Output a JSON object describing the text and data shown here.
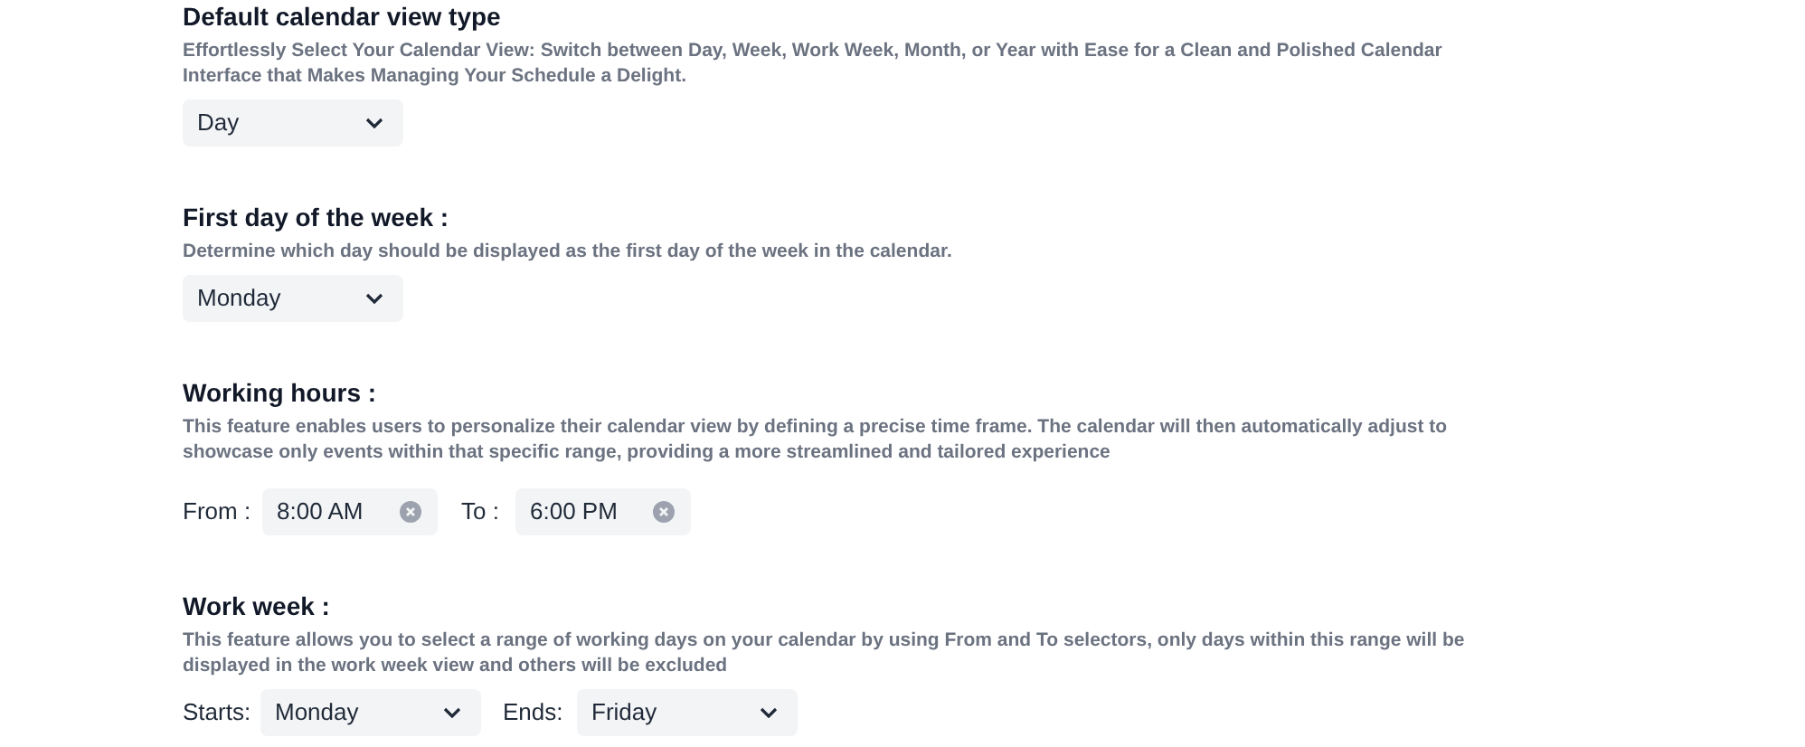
{
  "sections": [
    {
      "kind": "select",
      "title": "Default calendar view type",
      "description": "Effortlessly Select Your Calendar View: Switch between Day, Week, Work Week, Month, or Year with Ease for a Clean and Polished Calendar Interface that Makes Managing Your Schedule a Delight.",
      "value": "Day"
    },
    {
      "kind": "select",
      "title": "First day of the week :",
      "description": "Determine which day should be displayed as the first day of the week in the calendar.",
      "value": "Monday"
    },
    {
      "kind": "time_range",
      "title": "Working hours :",
      "description": "This feature enables users to personalize their calendar view by defining a precise time frame. The calendar will then automatically adjust to showcase only events within that specific range, providing a more streamlined and tailored experience",
      "fields": [
        {
          "label": "From :",
          "value": "8:00 AM"
        },
        {
          "label": "To :",
          "value": "6:00 PM"
        }
      ]
    },
    {
      "kind": "select_range",
      "title": "Work week :",
      "description": "This feature allows you to select a range of working days on your calendar by using From and To selectors, only days within this range will be displayed in the work week view and others will be excluded",
      "fields": [
        {
          "label": "Starts:",
          "value": "Monday"
        },
        {
          "label": "Ends:",
          "value": "Friday"
        }
      ]
    }
  ]
}
